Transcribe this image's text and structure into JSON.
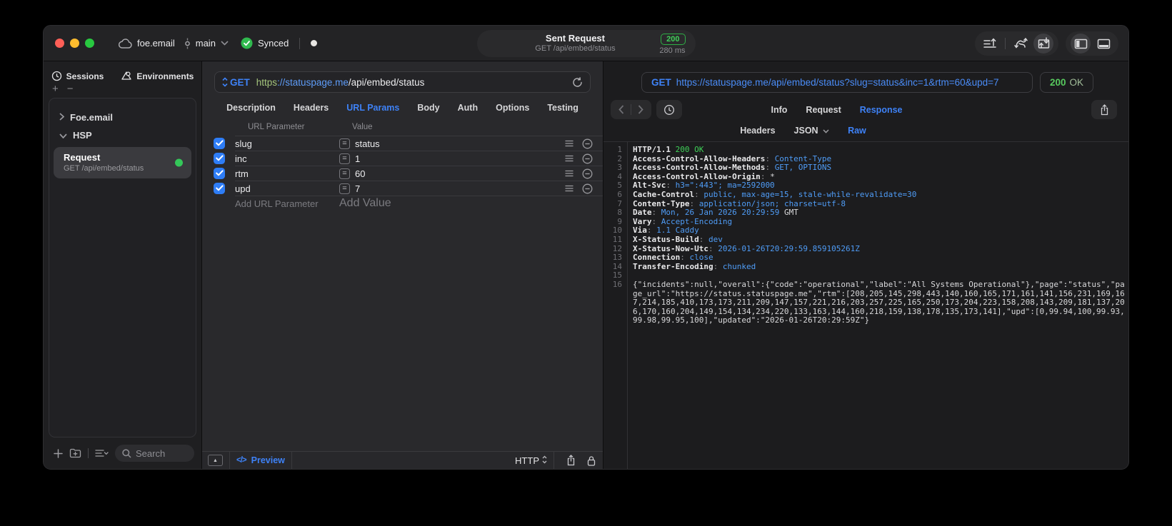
{
  "titlebar": {
    "project": "foe.email",
    "branch": "main",
    "sync_status": "Synced",
    "request_title": "Sent Request",
    "request_subtitle": "GET /api/embed/status",
    "status_code": "200",
    "duration": "280 ms"
  },
  "sidebar": {
    "tabs": [
      {
        "label": "Sessions"
      },
      {
        "label": "Environments"
      }
    ],
    "add_label": "+",
    "remove_label": "−",
    "tree": [
      {
        "label": "Foe.email"
      },
      {
        "label": "HSP"
      }
    ],
    "request_item": {
      "title": "Request",
      "subtitle": "GET /api/embed/status"
    },
    "search_placeholder": "Search"
  },
  "request_panel": {
    "method": "GET",
    "url": {
      "scheme": "https",
      "host": "://statuspage.me",
      "path": "/api/embed/status"
    },
    "tabs": [
      "Description",
      "Headers",
      "URL Params",
      "Body",
      "Auth",
      "Options",
      "Testing"
    ],
    "active_tab": "URL Params",
    "params_table": {
      "name_header": "URL Parameter",
      "value_header": "Value",
      "equals_glyph": "=",
      "rows": [
        {
          "name": "slug",
          "value": "status",
          "enabled": true
        },
        {
          "name": "inc",
          "value": "1",
          "enabled": true
        },
        {
          "name": "rtm",
          "value": "60",
          "enabled": true
        },
        {
          "name": "upd",
          "value": "7",
          "enabled": true
        }
      ],
      "add_name_placeholder": "Add URL Parameter",
      "add_value_placeholder": "Add Value"
    },
    "footer": {
      "preview_icon": "</>",
      "preview_label": "Preview",
      "protocol": "HTTP"
    }
  },
  "response_panel": {
    "method": "GET",
    "url": "https://statuspage.me/api/embed/status?slug=status&inc=1&rtm=60&upd=7",
    "status_code": "200",
    "status_text": "OK",
    "tabs": [
      "Info",
      "Request",
      "Response"
    ],
    "active_tab": "Response",
    "subtabs": [
      "Headers",
      "JSON",
      "Raw"
    ],
    "active_subtab": "Raw",
    "lines": [
      {
        "n": 1,
        "s": [
          [
            "HTTP/1.1 ",
            "n"
          ],
          [
            "200 OK",
            "g"
          ]
        ]
      },
      {
        "n": 2,
        "s": [
          [
            "Access-Control-Allow-Headers",
            "n"
          ],
          [
            ": ",
            "d"
          ],
          [
            "Content-Type",
            "b"
          ]
        ]
      },
      {
        "n": 3,
        "s": [
          [
            "Access-Control-Allow-Methods",
            "n"
          ],
          [
            ": ",
            "d"
          ],
          [
            "GET, OPTIONS",
            "b"
          ]
        ]
      },
      {
        "n": 4,
        "s": [
          [
            "Access-Control-Allow-Origin",
            "n"
          ],
          [
            ": ",
            "d"
          ],
          [
            "*",
            "p"
          ]
        ]
      },
      {
        "n": 5,
        "s": [
          [
            "Alt-Svc",
            "n"
          ],
          [
            ": ",
            "d"
          ],
          [
            "h3=\":443\"; ma=2592000",
            "b"
          ]
        ]
      },
      {
        "n": 6,
        "s": [
          [
            "Cache-Control",
            "n"
          ],
          [
            ": ",
            "d"
          ],
          [
            "public, max-age=15, stale-while-revalidate=30",
            "b"
          ]
        ]
      },
      {
        "n": 7,
        "s": [
          [
            "Content-Type",
            "n"
          ],
          [
            ": ",
            "d"
          ],
          [
            "application/json; charset=utf-8",
            "b"
          ]
        ]
      },
      {
        "n": 8,
        "s": [
          [
            "Date",
            "n"
          ],
          [
            ": ",
            "d"
          ],
          [
            "Mon, 26 Jan 2026 20:29:59",
            "b"
          ],
          [
            " GMT",
            "p"
          ]
        ]
      },
      {
        "n": 9,
        "s": [
          [
            "Vary",
            "n"
          ],
          [
            ": ",
            "d"
          ],
          [
            "Accept-Encoding",
            "b"
          ]
        ]
      },
      {
        "n": 10,
        "s": [
          [
            "Via",
            "n"
          ],
          [
            ": ",
            "d"
          ],
          [
            "1.1 Caddy",
            "b"
          ]
        ]
      },
      {
        "n": 11,
        "s": [
          [
            "X-Status-Build",
            "n"
          ],
          [
            ": ",
            "d"
          ],
          [
            "dev",
            "b"
          ]
        ]
      },
      {
        "n": 12,
        "s": [
          [
            "X-Status-Now-Utc",
            "n"
          ],
          [
            ": ",
            "d"
          ],
          [
            "2026-01-26T20:29:59.859105261Z",
            "b"
          ]
        ]
      },
      {
        "n": 13,
        "s": [
          [
            "Connection",
            "n"
          ],
          [
            ": ",
            "d"
          ],
          [
            "close",
            "b"
          ]
        ]
      },
      {
        "n": 14,
        "s": [
          [
            "Transfer-Encoding",
            "n"
          ],
          [
            ": ",
            "d"
          ],
          [
            "chunked",
            "b"
          ]
        ]
      },
      {
        "n": 15,
        "s": []
      },
      {
        "n": 16,
        "s": [
          [
            "{\"incidents\":null,\"overall\":{\"code\":\"operational\",\"label\":\"All Systems Operational\"},\"page\":\"status\",\"page_url\":\"https://status.statuspage.me\",\"rtm\":[208,205,145,298,443,140,160,165,171,161,141,156,231,169,167,214,185,410,173,173,211,209,147,157,221,216,203,257,225,165,250,173,204,223,158,208,143,209,181,137,206,170,160,204,149,154,134,234,220,133,163,144,160,218,159,138,178,135,173,141],\"upd\":[0,99.94,100,99.93,99.98,99.95,100],\"updated\":\"2026-01-26T20:29:59Z\"}",
            "p"
          ]
        ]
      }
    ]
  },
  "colors": {
    "accent_blue": "#3E82F7",
    "status_green": "#32D74B",
    "checkbox_blue": "#2E7DF6",
    "traffic_red": "#FF5F57",
    "traffic_yellow": "#FEBC2E",
    "traffic_green": "#28C840"
  }
}
